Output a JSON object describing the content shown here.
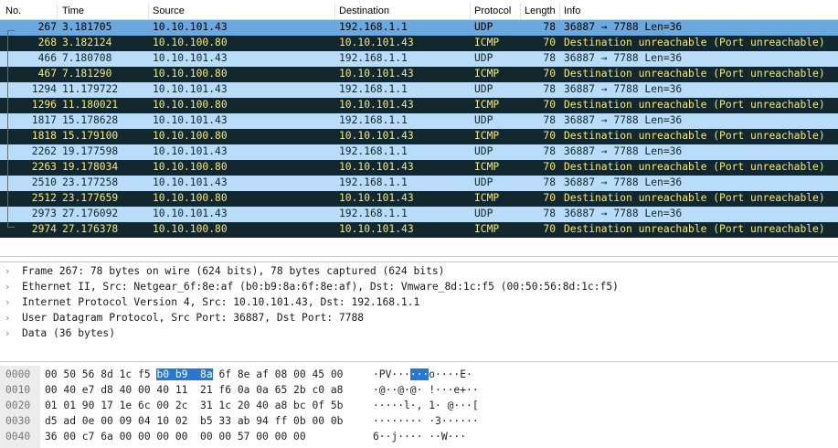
{
  "packet_list": {
    "columns": [
      "No.",
      "Time",
      "Source",
      "Destination",
      "Protocol",
      "Length",
      "Info"
    ],
    "rows": [
      {
        "no": "267",
        "time": "3.181705",
        "src": "10.10.101.43",
        "dst": "192.168.1.1",
        "proto": "UDP",
        "len": "78",
        "info": "36887 → 7788 Len=36"
      },
      {
        "no": "268",
        "time": "3.182124",
        "src": "10.10.100.80",
        "dst": "10.10.101.43",
        "proto": "ICMP",
        "len": "70",
        "info": "Destination unreachable (Port unreachable)"
      },
      {
        "no": "466",
        "time": "7.180708",
        "src": "10.10.101.43",
        "dst": "192.168.1.1",
        "proto": "UDP",
        "len": "78",
        "info": "36887 → 7788 Len=36"
      },
      {
        "no": "467",
        "time": "7.181290",
        "src": "10.10.100.80",
        "dst": "10.10.101.43",
        "proto": "ICMP",
        "len": "70",
        "info": "Destination unreachable (Port unreachable)"
      },
      {
        "no": "1294",
        "time": "11.179722",
        "src": "10.10.101.43",
        "dst": "192.168.1.1",
        "proto": "UDP",
        "len": "78",
        "info": "36887 → 7788 Len=36"
      },
      {
        "no": "1296",
        "time": "11.180021",
        "src": "10.10.100.80",
        "dst": "10.10.101.43",
        "proto": "ICMP",
        "len": "70",
        "info": "Destination unreachable (Port unreachable)"
      },
      {
        "no": "1817",
        "time": "15.178628",
        "src": "10.10.101.43",
        "dst": "192.168.1.1",
        "proto": "UDP",
        "len": "78",
        "info": "36887 → 7788 Len=36"
      },
      {
        "no": "1818",
        "time": "15.179100",
        "src": "10.10.100.80",
        "dst": "10.10.101.43",
        "proto": "ICMP",
        "len": "70",
        "info": "Destination unreachable (Port unreachable)"
      },
      {
        "no": "2262",
        "time": "19.177598",
        "src": "10.10.101.43",
        "dst": "192.168.1.1",
        "proto": "UDP",
        "len": "78",
        "info": "36887 → 7788 Len=36"
      },
      {
        "no": "2263",
        "time": "19.178034",
        "src": "10.10.100.80",
        "dst": "10.10.101.43",
        "proto": "ICMP",
        "len": "70",
        "info": "Destination unreachable (Port unreachable)"
      },
      {
        "no": "2510",
        "time": "23.177258",
        "src": "10.10.101.43",
        "dst": "192.168.1.1",
        "proto": "UDP",
        "len": "78",
        "info": "36887 → 7788 Len=36"
      },
      {
        "no": "2512",
        "time": "23.177659",
        "src": "10.10.100.80",
        "dst": "10.10.101.43",
        "proto": "ICMP",
        "len": "70",
        "info": "Destination unreachable (Port unreachable)"
      },
      {
        "no": "2973",
        "time": "27.176092",
        "src": "10.10.101.43",
        "dst": "192.168.1.1",
        "proto": "UDP",
        "len": "78",
        "info": "36887 → 7788 Len=36"
      },
      {
        "no": "2974",
        "time": "27.176378",
        "src": "10.10.100.80",
        "dst": "10.10.101.43",
        "proto": "ICMP",
        "len": "70",
        "info": "Destination unreachable (Port unreachable)"
      }
    ]
  },
  "details": {
    "items": [
      "Frame 267: 78 bytes on wire (624 bits), 78 bytes captured (624 bits)",
      "Ethernet II, Src: Netgear_6f:8e:af (b0:b9:8a:6f:8e:af), Dst: Vmware_8d:1c:f5 (00:50:56:8d:1c:f5)",
      "Internet Protocol Version 4, Src: 10.10.101.43, Dst: 192.168.1.1",
      "User Datagram Protocol, Src Port: 36887, Dst Port: 7788",
      "Data (36 bytes)"
    ]
  },
  "bytes": {
    "lines": [
      {
        "offset": "0000",
        "hex_pre": "00 50 56 8d 1c f5 ",
        "hex_hl": "b0 b9  8a",
        "hex_post": " 6f 8e af 08 00 45 00",
        "ascii_pre": "·PV···",
        "ascii_hl": "···",
        "ascii_post": "o····E·"
      },
      {
        "offset": "0010",
        "hex_pre": "00 40 e7 d8 40 00 40 11  21 f6 0a 0a 65 2b c0 a8",
        "hex_hl": "",
        "hex_post": "",
        "ascii_pre": "·@··@·@· !···e+··",
        "ascii_hl": "",
        "ascii_post": ""
      },
      {
        "offset": "0020",
        "hex_pre": "01 01 90 17 1e 6c 00 2c  31 1c 20 40 a8 bc 0f 5b",
        "hex_hl": "",
        "hex_post": "",
        "ascii_pre": "·····l·, 1· @···[",
        "ascii_hl": "",
        "ascii_post": ""
      },
      {
        "offset": "0030",
        "hex_pre": "d5 ad 0e 00 09 04 10 02  b5 33 ab 94 ff 0b 00 0b",
        "hex_hl": "",
        "hex_post": "",
        "ascii_pre": "········ ·3······",
        "ascii_hl": "",
        "ascii_post": ""
      },
      {
        "offset": "0040",
        "hex_pre": "36 00 c7 6a 00 00 00 00  00 00 57 00 00 00",
        "hex_hl": "",
        "hex_post": "",
        "ascii_pre": "6··j···· ··W···",
        "ascii_hl": "",
        "ascii_post": ""
      }
    ]
  },
  "colors": {
    "udp_row_bg": "#b9dcf8",
    "icmp_row_bg": "#12272e",
    "icmp_row_fg": "#f7e875",
    "selected_row_bg": "#6aa8de",
    "byte_highlight": "#2778d3"
  }
}
